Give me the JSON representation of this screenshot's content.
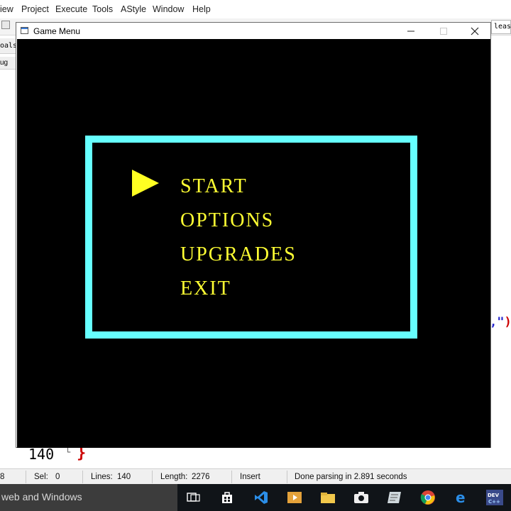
{
  "ide": {
    "menubar": [
      "iew",
      "Project",
      "Execute",
      "Tools",
      "AStyle",
      "Window",
      "Help"
    ],
    "toolbar_right_text": "lease",
    "left_tab_text": "oals",
    "left_tab2_text": "ug",
    "code_fragment_right": {
      "quote_part": ",\"",
      "paren_part": ")"
    },
    "bottom_line_number": "140",
    "bottom_brace": "}",
    "fold_mark": "└"
  },
  "statusbar": {
    "col": "8",
    "sel_label": "Sel:",
    "sel_value": "0",
    "lines_label": "Lines:",
    "lines_value": "140",
    "length_label": "Length:",
    "length_value": "2276",
    "mode": "Insert",
    "message": "Done parsing in 2.891 seconds"
  },
  "taskbar": {
    "search_text": "web and Windows",
    "icons": [
      "task-view-icon",
      "store-icon",
      "vscode-icon",
      "media-player-icon",
      "file-explorer-icon",
      "camera-icon",
      "notes-icon",
      "chrome-icon",
      "edge-icon",
      "devcpp-icon"
    ]
  },
  "game_window": {
    "title": "Game Menu",
    "menu_options": [
      "START",
      "OPTIONS",
      "UPGRADES",
      "EXIT"
    ],
    "selected_index": 0,
    "colors": {
      "frame": "#66ffff",
      "text": "#ffff33",
      "cursor": "#ffff22",
      "background": "#000000"
    }
  }
}
